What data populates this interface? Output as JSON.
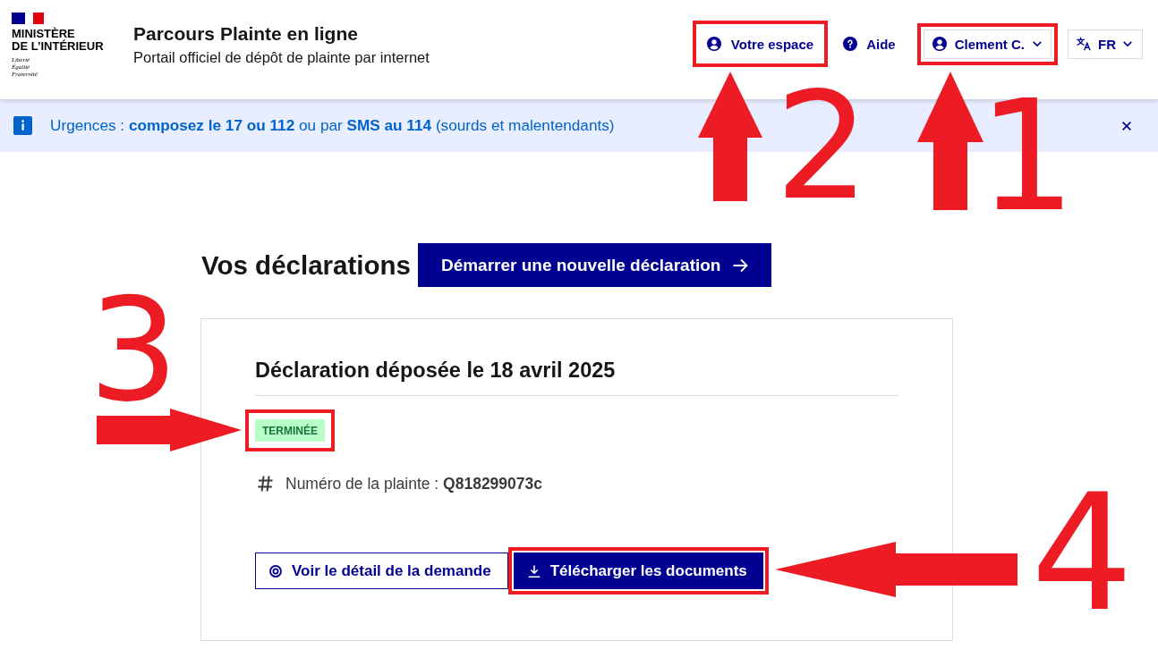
{
  "header": {
    "logo": {
      "ministry": [
        "MINISTÈRE",
        "DE L’INTÉRIEUR"
      ],
      "motto": [
        "Liberté",
        "Égalité",
        "Fraternité"
      ]
    },
    "title": "Parcours Plainte en ligne",
    "subtitle": "Portail officiel de dépôt de plainte par internet",
    "nav": [
      {
        "kind": "account",
        "label": "Votre espace",
        "highlighted": true
      },
      {
        "kind": "help",
        "label": "Aide",
        "highlighted": false
      },
      {
        "kind": "account-menu",
        "label": "Clement C.",
        "highlighted": true
      },
      {
        "kind": "language",
        "label": "FR",
        "highlighted": false
      }
    ]
  },
  "notice": {
    "text": "Urgences : **composez le 17 ou 112** ou par **SMS au 114** (sourds et malentendants)"
  },
  "main": {
    "heading": "Vos déclarations",
    "new_declaration_button": "Démarrer une nouvelle déclaration",
    "declarations": [
      {
        "title": "Déclaration déposée le 18 avril 2025",
        "status": {
          "label": "TERMINÉE",
          "highlighted": true
        },
        "complaint_number": "Numéro de la plainte : **Q818299073c**",
        "actions": [
          {
            "kind": "secondary",
            "label": "Voir le détail de la demande",
            "highlighted": false
          },
          {
            "kind": "primary",
            "label": "Télécharger les documents",
            "highlighted": true
          }
        ]
      }
    ]
  },
  "annotations": [
    {
      "kind": "arrow-up",
      "label": "2"
    },
    {
      "kind": "arrow-up",
      "label": "1"
    },
    {
      "kind": "arrow-right",
      "label": "3"
    },
    {
      "kind": "arrow-left",
      "label": "4"
    }
  ]
}
